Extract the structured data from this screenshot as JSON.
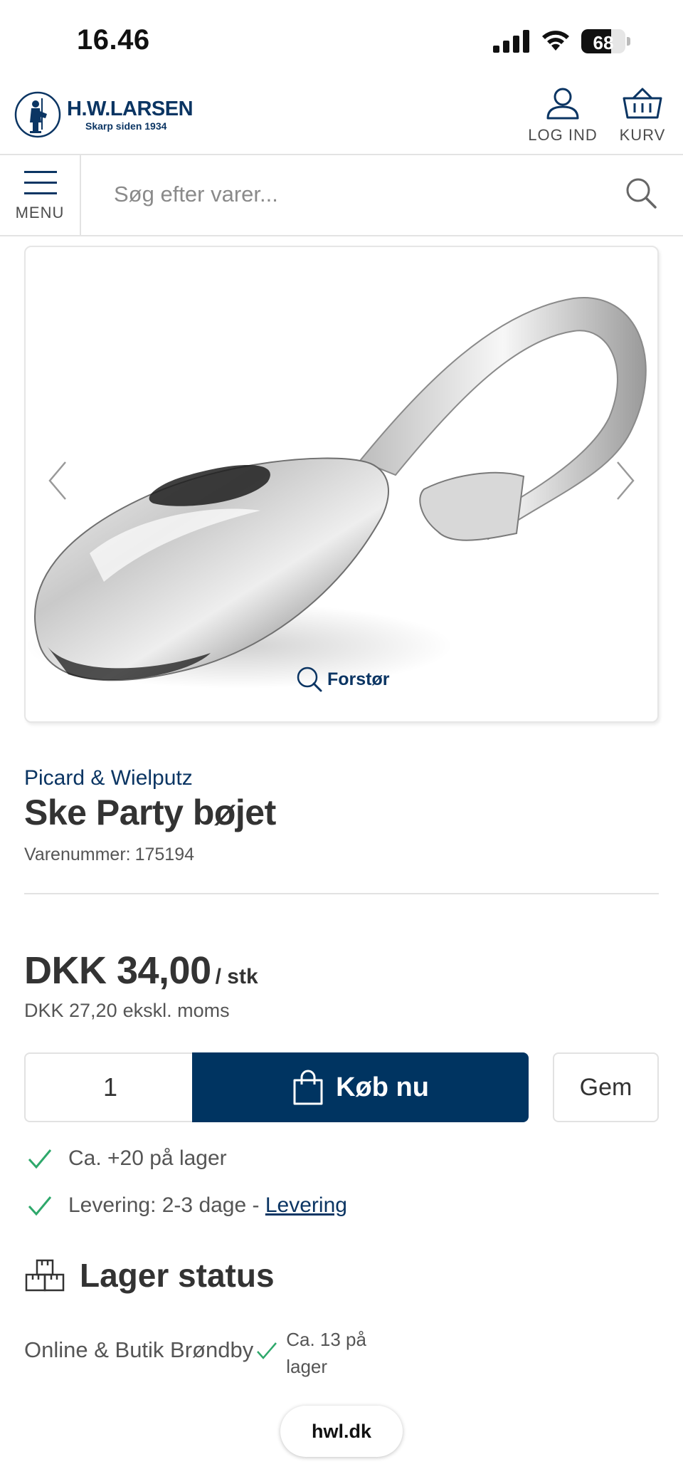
{
  "status_bar": {
    "time": "16.46",
    "battery": "68",
    "battery_level_percent": 68,
    "icons": [
      "cellular-signal-icon",
      "wifi-icon",
      "battery-icon"
    ]
  },
  "header": {
    "logo": {
      "name": "H.W.LARSEN",
      "tagline": "Skarp siden 1934",
      "icon": "knight-emblem-icon"
    },
    "login_label": "LOG IND",
    "cart_label": "KURV"
  },
  "nav": {
    "menu_label": "MENU",
    "search_placeholder": "Søg efter varer..."
  },
  "gallery": {
    "zoom_label": "Forstør",
    "image": "spoon-product-image",
    "icons": [
      "chevron-left-icon",
      "chevron-right-icon",
      "magnifier-icon"
    ]
  },
  "product": {
    "brand": "Picard & Wielputz",
    "title": "Ske Party bøjet",
    "sku_label": "Varenummer:",
    "sku_value": "175194",
    "price": "DKK 34,00",
    "price_unit": "/ stk",
    "price_ex_vat": "DKK 27,20",
    "price_ex_vat_label": "ekskl. moms"
  },
  "purchase": {
    "quantity": "1",
    "buy_label": "Køb nu",
    "save_label": "Gem"
  },
  "availability": {
    "stock_text": "Ca. +20 på lager",
    "delivery_text": "Levering: 2-3 dage -",
    "delivery_link": "Levering"
  },
  "lager_status": {
    "title": "Lager status",
    "store_name": "Online & Butik Brøndby",
    "store_quantity": "Ca. 13 på lager"
  },
  "browser": {
    "url": "hwl.dk"
  },
  "colors": {
    "brand_navy": "#003461",
    "check_green": "#2ea86b",
    "text_dark": "#333333"
  }
}
